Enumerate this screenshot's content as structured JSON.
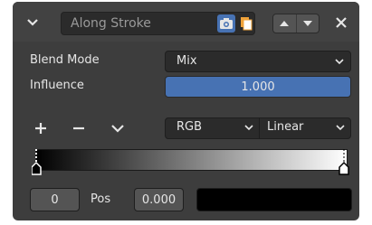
{
  "header": {
    "name_value": "Along Stroke",
    "toggles": {
      "camera_icon": "camera-icon",
      "copy_icon": "copy-icon"
    },
    "colors": {
      "toggle_active": "#4772b3",
      "copy_orange": "#f0a33a"
    }
  },
  "properties": {
    "blend_mode_label": "Blend Mode",
    "blend_mode_value": "Mix",
    "influence_label": "Influence",
    "influence_value": "1.000",
    "accent_color": "#4772b3"
  },
  "ramp": {
    "add_icon": "plus-icon",
    "remove_icon": "minus-icon",
    "menu_icon": "chevron-down-icon",
    "color_mode": "RGB",
    "interpolation": "Linear",
    "gradient_start": "#000000",
    "gradient_end": "#ffffff"
  },
  "stop": {
    "index_value": "0",
    "pos_label": "Pos",
    "pos_value": "0.000",
    "color": "#000000"
  }
}
